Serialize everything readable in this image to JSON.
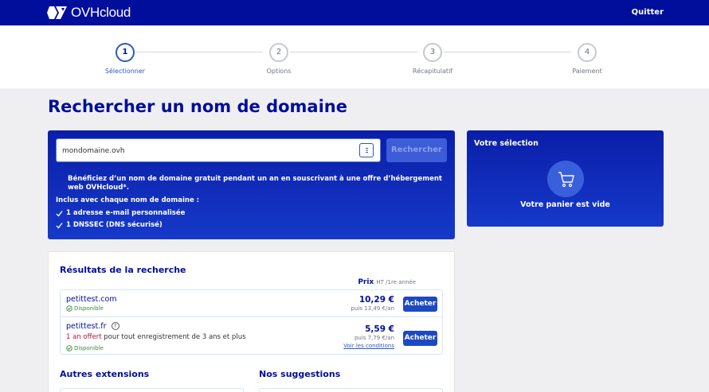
{
  "header": {
    "logo_text": "OVHcloud",
    "quit_label": "Quitter"
  },
  "stepper": {
    "steps": [
      {
        "number": "1",
        "label": "Sélectionner",
        "active": true
      },
      {
        "number": "2",
        "label": "Options",
        "active": false
      },
      {
        "number": "3",
        "label": "Récapitulatif",
        "active": false
      },
      {
        "number": "4",
        "label": "Paiement",
        "active": false
      }
    ]
  },
  "page": {
    "title": "Rechercher un nom de domaine"
  },
  "search": {
    "value": "mondomaine.ovh",
    "button_label": "Rechercher",
    "promo_text": "Bénéficiez d’un nom de domaine gratuit pendant un an en souscrivant à une offre d’hébergement web OVHcloud*.",
    "included_title": "Inclus avec chaque nom de domaine :",
    "included_items": [
      "1 adresse e-mail personnalisée",
      "1 DNSSEC (DNS sécurisé)"
    ]
  },
  "cart": {
    "title": "Votre sélection",
    "empty_text": "Votre panier est vide"
  },
  "results": {
    "title": "Résultats de la recherche",
    "price_label": "Prix",
    "price_note": "HT /1re année",
    "rows": [
      {
        "domain": "petittest.com",
        "status": "Disponible",
        "price": "10,29 €",
        "renewal": "puis 13,49 €/an",
        "buy_label": "Acheter"
      },
      {
        "domain": "petittest.fr",
        "offer_highlight": "1 an offert",
        "offer_rest": " pour tout enregistrement de 3 ans et plus",
        "status": "Disponible",
        "price": "5,59 €",
        "renewal": "puis 7,79 €/an",
        "conditions": "Voir les conditions",
        "buy_label": "Acheter"
      }
    ],
    "other_extensions_title": "Autres extensions",
    "suggestions_title": "Nos suggestions"
  },
  "colors": {
    "brand": "#000e9c",
    "accent": "#2859c5",
    "available": "#3a8a3a",
    "offer": "#b4153b"
  }
}
